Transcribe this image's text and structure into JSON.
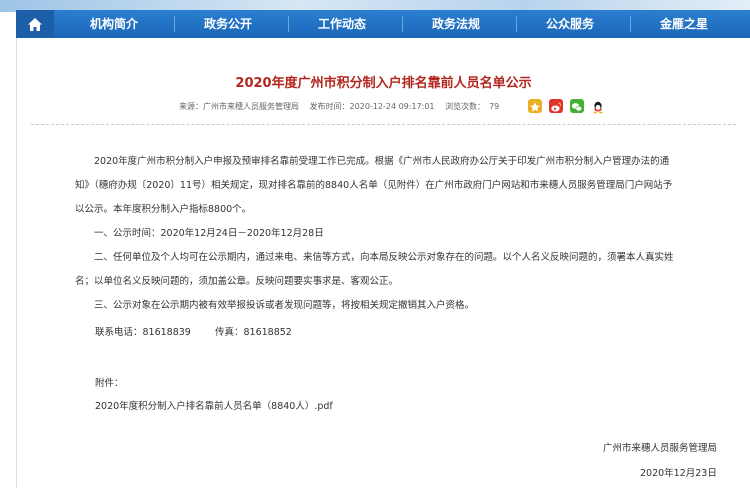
{
  "nav": {
    "items": [
      "机构简介",
      "政务公开",
      "工作动态",
      "政务法规",
      "公众服务",
      "金雁之星"
    ]
  },
  "article": {
    "title": "2020年度广州市积分制入户排名靠前人员名单公示",
    "meta": {
      "source": "来源：广州市来穗人员服务管理局",
      "date": "发布时间：2020-12-24 09:17:01",
      "views_label": "浏览次数：",
      "views": "79"
    },
    "intro": "2020年度广州市积分制入户申报及预审排名靠前受理工作已完成。根据《广州市人民政府办公厅关于印发广州市积分制入户管理办法的通知》（穗府办规〔2020〕11号）相关规定，现对排名靠前的8840人名单（见附件）在广州市政府门户网站和市来穗人员服务管理局门户网站予以公示。本年度积分制入户指标8800个。",
    "item1": "一、公示时间：2020年12月24日－2020年12月28日",
    "item2": "二、任何单位及个人均可在公示期内，通过来电、来信等方式，向本局反映公示对象存在的问题。以个人名义反映问题的，须署本人真实姓名；以单位名义反映问题的，须加盖公章。反映问题要实事求是、客观公正。",
    "item3": "三、公示对象在公示期内被有效举报投诉或者发现问题等，将按相关规定撤销其入户资格。",
    "phone": "联系电话：81618839",
    "fax": "传真：81618852",
    "attachment_label": "附件：",
    "attachment_file": "2020年度积分制入户排名靠前人员名单（8840人）.pdf",
    "signature": "广州市来穗人员服务管理局",
    "sign_date": "2020年12月23日"
  }
}
